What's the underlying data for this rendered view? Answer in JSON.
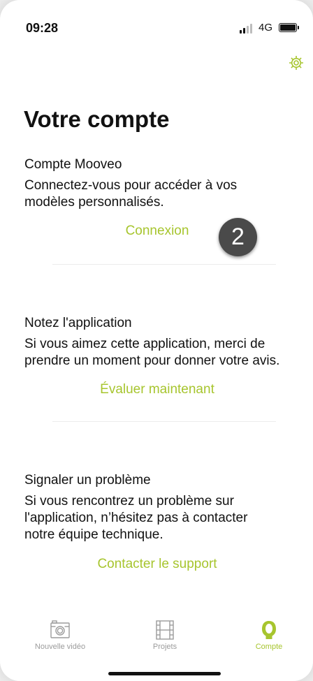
{
  "colors": {
    "accent": "#a7c52e",
    "text": "#111111",
    "tab_inactive": "#9b9b9b",
    "badge": "#4a4a4a"
  },
  "status_bar": {
    "time": "09:28",
    "network": "4G"
  },
  "header": {
    "title": "Votre compte",
    "settings_icon": "gear-icon"
  },
  "sections": [
    {
      "title": "Compte Mooveo",
      "description": "Connectez-vous pour accéder à vos modèles personnalisés.",
      "action": "Connexion"
    },
    {
      "title": "Notez l'application",
      "description": "Si vous aimez cette application, merci de prendre un moment pour donner votre avis.",
      "action": "Évaluer maintenant"
    },
    {
      "title": "Signaler un problème",
      "description": "Si vous rencontrez un problème sur l'application, n’hésitez pas à contacter notre équipe technique.",
      "action": "Contacter le support"
    }
  ],
  "badge": {
    "number": "2"
  },
  "tab_bar": {
    "tabs": [
      {
        "label": "Nouvelle vidéo",
        "icon": "camera-icon",
        "active": false
      },
      {
        "label": "Projets",
        "icon": "film-icon",
        "active": false
      },
      {
        "label": "Compte",
        "icon": "account-icon",
        "active": true
      }
    ]
  }
}
